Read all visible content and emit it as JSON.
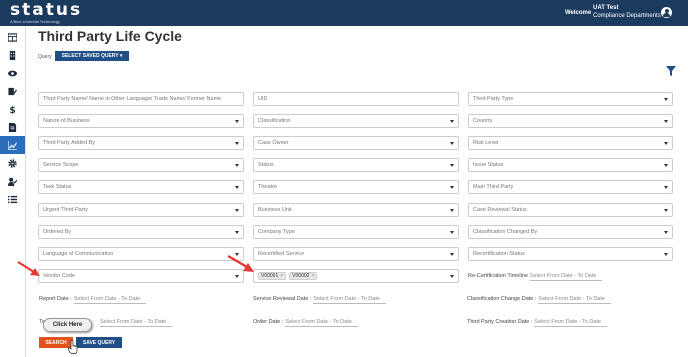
{
  "header": {
    "logo": "status",
    "tagline": "A Blue Umbrella Technology",
    "welcome": "Welcome",
    "user_name": "UAT Test",
    "user_dept": "Compliance Departments"
  },
  "sidebar": {
    "items": [
      {
        "icon": "dashboard-icon"
      },
      {
        "icon": "building-icon"
      },
      {
        "icon": "eye-icon"
      },
      {
        "icon": "edit-document-icon"
      },
      {
        "icon": "dollar-icon"
      },
      {
        "icon": "document-icon"
      },
      {
        "icon": "chart-icon",
        "active": true
      },
      {
        "icon": "gear-icon"
      },
      {
        "icon": "user-check-icon"
      },
      {
        "icon": "list-icon"
      }
    ]
  },
  "page": {
    "title": "Third Party Life Cycle",
    "query_label": "Query",
    "saved_query_button": "SELECT SAVED QUERY ▾"
  },
  "fields": {
    "third_party_name": "Third Party Name/ Name in Other Language/ Trade Name/ Former Name",
    "uid": "UID",
    "third_party_type": "Third Party Type",
    "nature_of_business": "Nature of Business",
    "classification": "Classification",
    "country": "Country",
    "third_party_added_by": "Third Party Added By",
    "case_owner": "Case Owner",
    "risk_level": "Risk Level",
    "service_scope": "Service Scope",
    "status": "Status",
    "issue_status": "Issue Status",
    "task_status": "Task Status",
    "theatre": "Theatre",
    "main_third_party": "Main Third Party",
    "urgent_third_party": "Urgent Third Party",
    "business_unit": "Business Unit",
    "case_reviewal_status": "Case Reviewal Status",
    "ordered_by": "Ordered By",
    "company_type": "Company Type",
    "classification_changed_by": "Classification Changed By",
    "language_of_communication": "Language of Communication",
    "recertified_service": "Recertified Service",
    "recertification_status": "Recertification Status",
    "vendor_code": "Vendor Code",
    "vendor_tags": [
      "V00001",
      "V00002"
    ],
    "tag_remove": "×"
  },
  "dates": {
    "placeholder": "Select From Date - To Date",
    "recertification_timeline": "Re-Certification Timeline",
    "report_date": "Report Date :",
    "service_reviewal_date": "Service Reviewal Date :",
    "classification_change_date": "Classification Change Date :",
    "task_date_prefix": "Ta",
    "order_date": "Order Date :",
    "third_party_creation_date": "Third Party Creation Date :"
  },
  "actions": {
    "search": "SEARCH",
    "save_query": "SAVE QUERY",
    "tooltip": "Click Here"
  },
  "colors": {
    "header_bg": "#1b3b5e",
    "accent_blue": "#1f4f86",
    "active_sidebar": "#2a6ebb",
    "search_orange": "#e2521d",
    "arrow_red": "#e53935"
  }
}
